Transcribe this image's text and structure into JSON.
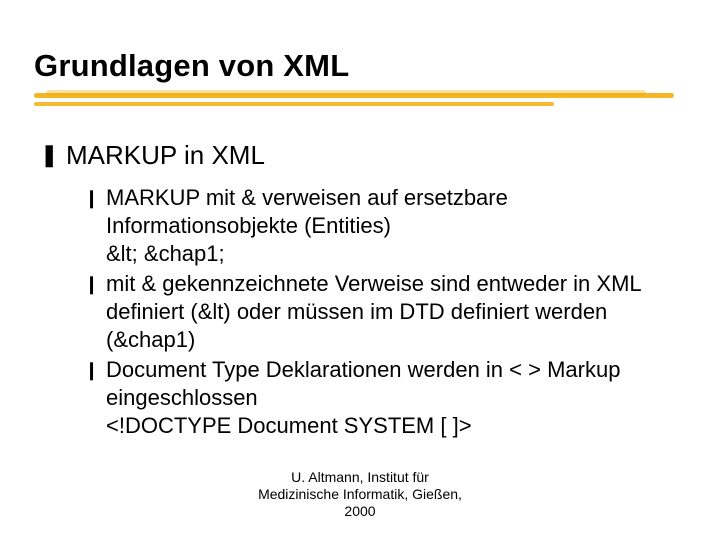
{
  "title": "Grundlagen von XML",
  "level1": {
    "bullet_glyph": "❚",
    "text": "MARKUP in XML"
  },
  "level2": {
    "bullet_glyph": "❙",
    "items": [
      "MARKUP mit & verweisen auf ersetzbare Informationsobjekte (Entities)\n&lt;  &chap1;",
      "mit & gekennzeichnete Verweise sind entweder in XML definiert (&lt) oder müssen im DTD definiert werden (&chap1)",
      "Document Type Deklarationen werden in < > Markup eingeschlossen\n<!DOCTYPE Document SYSTEM [  ]>"
    ]
  },
  "footer": "U. Altmann, Institut für\nMedizinische Informatik, Gießen,\n2000"
}
